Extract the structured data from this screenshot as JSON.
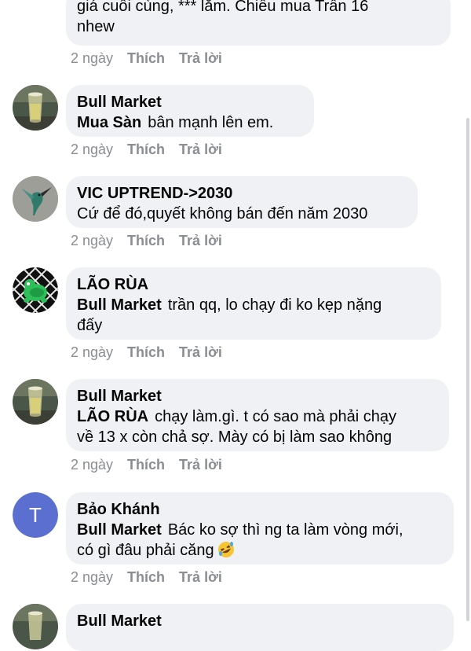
{
  "comments": [
    {
      "author": "",
      "lines": [
        {
          "mention": "",
          "text": "giá cuối cùng, *** lắm. Chiều mua Trần 16"
        },
        {
          "mention": "",
          "text": "nhew"
        }
      ],
      "time": "2 ngày",
      "like": "Thích",
      "reply": "Trả lời",
      "avatar": "none"
    },
    {
      "author": "Bull Market",
      "lines": [
        {
          "mention": "Mua Sàn",
          "text": "bân mạnh lên em."
        }
      ],
      "time": "2 ngày",
      "like": "Thích",
      "reply": "Trả lời",
      "avatar": "glass-photo-avatar"
    },
    {
      "author": "VIC UPTREND->2030",
      "lines": [
        {
          "mention": "",
          "text": "Cứ để đó,quyết không bán đến năm 2030"
        }
      ],
      "time": "2 ngày",
      "like": "Thích",
      "reply": "Trả lời",
      "avatar": "hummingbird-photo-avatar"
    },
    {
      "author": "LÃO RÙA",
      "lines": [
        {
          "mention": "Bull Market",
          "text": "trần qq, lo chạy đi ko kẹp nặng"
        },
        {
          "mention": "",
          "text": "đấy"
        }
      ],
      "time": "2 ngày",
      "like": "Thích",
      "reply": "Trả lời",
      "avatar": "turtle-avatar"
    },
    {
      "author": "Bull Market",
      "lines": [
        {
          "mention": "LÃO RÙA",
          "text": "chạy làm.gì. t có sao mà phải chạy"
        },
        {
          "mention": "",
          "text": "về 13 x còn chả sợ. Mày có bị làm sao không"
        }
      ],
      "time": "2 ngày",
      "like": "Thích",
      "reply": "Trả lời",
      "avatar": "glass-photo-avatar"
    },
    {
      "author": "Bảo Khánh",
      "lines": [
        {
          "mention": "Bull Market",
          "text": "Bác ko sợ thì ng ta làm vòng mới,"
        },
        {
          "mention": "",
          "text": "có gì đâu phải căng"
        }
      ],
      "time": "2 ngày",
      "like": "Thích",
      "reply": "Trả lời",
      "avatar": "letter-avatar",
      "avatar_letter": "T"
    },
    {
      "author": "Bull Market",
      "lines": [],
      "time": "",
      "like": "",
      "reply": "",
      "avatar": "glass-photo-avatar"
    }
  ],
  "colors": {
    "bubble": "#eff1f4",
    "meta_text": "#8a8d91",
    "letter_avatar_bg": "#5b6fd0"
  }
}
